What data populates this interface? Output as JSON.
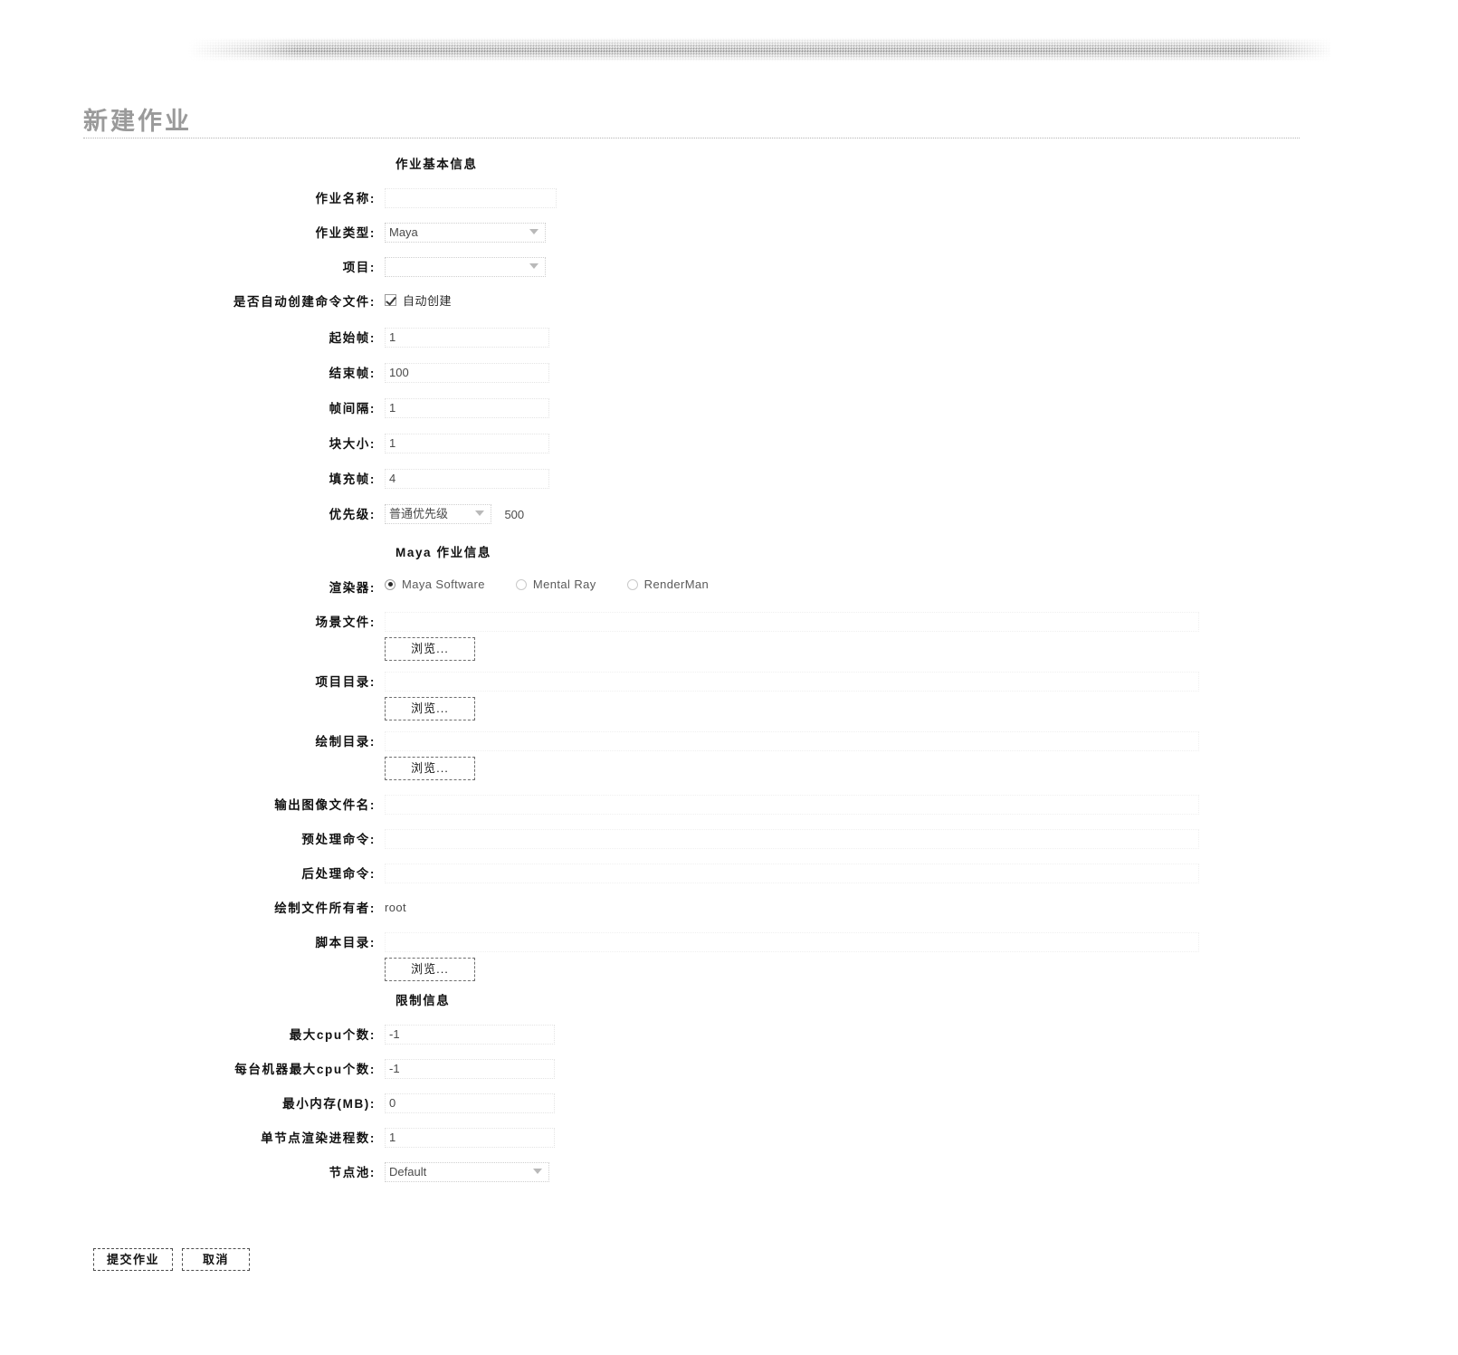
{
  "page": {
    "title": "新建作业",
    "banner_style": "gradient-rule"
  },
  "sections": {
    "basic": "作业基本信息",
    "maya": "Maya 作业信息",
    "limit": "限制信息"
  },
  "basic_info": {
    "job_name": {
      "label": "作业名称:",
      "value": "",
      "control": "text"
    },
    "job_type": {
      "label": "作业类型:",
      "value": "Maya",
      "control": "select"
    },
    "project": {
      "label": "项目:",
      "value": "",
      "control": "select"
    },
    "auto_create_cmd": {
      "label": "是否自动创建命令文件:",
      "checkbox_label": "自动创建",
      "checked": true,
      "control": "checkbox"
    },
    "start_frame": {
      "label": "起始帧:",
      "value": "1",
      "control": "text"
    },
    "end_frame": {
      "label": "结束帧:",
      "value": "100",
      "control": "text"
    },
    "frame_step": {
      "label": "帧间隔:",
      "value": "1",
      "control": "text"
    },
    "block_size": {
      "label": "块大小:",
      "value": "1",
      "control": "text"
    },
    "frame_padding": {
      "label": "填充帧:",
      "value": "4",
      "control": "text"
    },
    "priority": {
      "label": "优先级:",
      "value": "普通优先级",
      "number": "500",
      "control": "select+text"
    }
  },
  "maya_info": {
    "renderer": {
      "label": "渲染器:",
      "options": [
        "Maya Software",
        "Mental Ray",
        "RenderMan"
      ],
      "selected": "Maya Software",
      "control": "radio"
    },
    "scene_file": {
      "label": "场景文件:",
      "value": "",
      "browse": "浏览..."
    },
    "project_dir": {
      "label": "项目目录:",
      "value": "",
      "browse": "浏览..."
    },
    "render_dir": {
      "label": "绘制目录:",
      "value": "",
      "browse": "浏览..."
    },
    "output_image_name": {
      "label": "输出图像文件名:",
      "value": ""
    },
    "pre_command": {
      "label": "预处理命令:",
      "value": ""
    },
    "post_command": {
      "label": "后处理命令:",
      "value": ""
    },
    "file_owner": {
      "label": "绘制文件所有者:",
      "value": "root"
    },
    "script_dir": {
      "label": "脚本目录:",
      "value": "",
      "browse": "浏览..."
    }
  },
  "limit_info": {
    "max_cpu": {
      "label": "最大cpu个数:",
      "value": "-1"
    },
    "max_cpu_per_host": {
      "label": "每台机器最大cpu个数:",
      "value": "-1"
    },
    "min_memory": {
      "label": "最小内存(MB):",
      "value": "0"
    },
    "procs_per_node": {
      "label": "单节点渲染进程数:",
      "value": "1"
    },
    "node_pool": {
      "label": "节点池:",
      "value": "Default",
      "control": "select"
    }
  },
  "footer": {
    "submit_label": "提交作业",
    "cancel_label": "取消"
  },
  "colors": {
    "title_gray": "#9a9a9a",
    "text": "#1a1a1a",
    "input_border": "#cfcfcf",
    "button_border": "#4d4d4d"
  }
}
